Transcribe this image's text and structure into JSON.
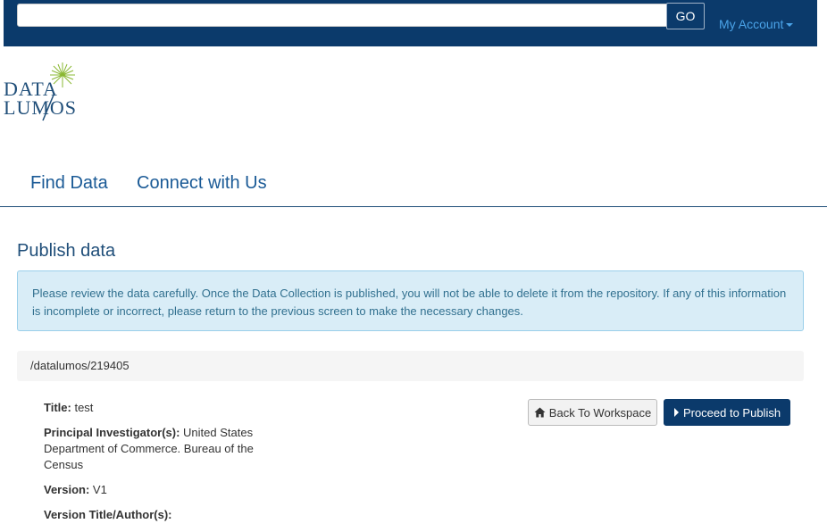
{
  "header": {
    "search": {
      "value": "",
      "placeholder": ""
    },
    "go_label": "GO",
    "account_label": "My Account"
  },
  "logo": {
    "line1": "DATA",
    "line2": "LUMOS"
  },
  "nav": {
    "items": [
      {
        "label": "Find Data"
      },
      {
        "label": "Connect with Us"
      }
    ]
  },
  "main": {
    "title": "Publish data",
    "alert_text": "Please review the data carefully. Once the Data Collection is published, you will not be able to delete it from the repository. If any of this information is incomplete or incorrect, please return to the previous screen to make the necessary changes.",
    "path": "/datalumos/219405",
    "fields": [
      {
        "label": "Title:",
        "value": "test"
      },
      {
        "label": "Principal Investigator(s):",
        "value": "United States Department of Commerce. Bureau of the Census"
      },
      {
        "label": "Version:",
        "value": "V1"
      },
      {
        "label": "Version Title/Author(s):",
        "value": ""
      }
    ],
    "back_button": "Back To Workspace",
    "proceed_button": "Proceed to Publish"
  },
  "colors": {
    "brand_navy": "#0b3a6b",
    "link_blue": "#1a5a96",
    "alert_bg": "#d9edf7",
    "logo_green": "#8ab833"
  }
}
